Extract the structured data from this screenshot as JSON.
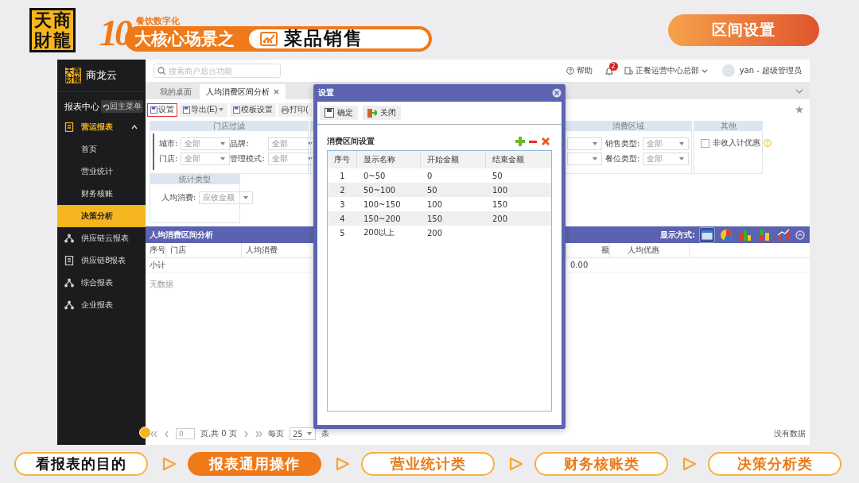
{
  "header": {
    "logo": "天商財龍",
    "number": "10",
    "subtitle": "餐饮数字化",
    "banner_text": "大核心场景之",
    "topic": "菜品销售",
    "section_badge": "区间设置"
  },
  "app": {
    "sidebar": {
      "logo": "天商財龍",
      "brand": "商龙云",
      "section": "报表中心",
      "back_button": "回主菜单",
      "groups": [
        {
          "label": "营运报表",
          "kind": "doc",
          "expanded": true,
          "children": [
            {
              "label": "首页",
              "selected": false
            },
            {
              "label": "营业统计",
              "selected": false
            },
            {
              "label": "财务核账",
              "selected": false
            },
            {
              "label": "决策分析",
              "selected": true
            }
          ]
        },
        {
          "label": "供应链云报表",
          "kind": "network"
        },
        {
          "label": "供应链8报表",
          "kind": "doc"
        },
        {
          "label": "综合报表",
          "kind": "network"
        },
        {
          "label": "企业报表",
          "kind": "network"
        }
      ]
    },
    "topbar": {
      "search_placeholder": "搜索商户后台功能",
      "help": "帮助",
      "notifications": "2",
      "org": "正餐运营中心总部",
      "user": "yan - 超级管理员"
    },
    "tabs": [
      {
        "label": "我的桌面",
        "selected": false
      },
      {
        "label": "人均消费区间分析",
        "selected": true
      }
    ],
    "toolbar": [
      {
        "label": "设置",
        "highlighted": true,
        "dropdown": false
      },
      {
        "label": "导出(E)",
        "highlighted": false,
        "dropdown": true
      },
      {
        "label": "模板设置",
        "highlighted": false,
        "dropdown": false
      },
      {
        "label": "打印(",
        "highlighted": false,
        "dropdown": false
      }
    ],
    "store_filter": {
      "title": "门店过滤",
      "fields": [
        {
          "label": "城市:",
          "value": "全部"
        },
        {
          "label": "品牌:",
          "value": "全部"
        },
        {
          "label": "门店:",
          "value": "全部"
        },
        {
          "label": "管理模式:",
          "value": "全部"
        }
      ]
    },
    "stat_type": {
      "title": "统计类型",
      "fields": [
        {
          "label": "人均消费:",
          "value": "应收金额"
        }
      ]
    },
    "consumption_area": {
      "title": "消费区域",
      "fields": [
        {
          "label": "销售类型:",
          "value": "全部"
        },
        {
          "label": "餐位类型:",
          "value": "全部"
        }
      ]
    },
    "other": {
      "title": "其他",
      "checkbox": {
        "label": "非收入计优惠",
        "checked": false
      }
    },
    "report": {
      "title": "人均消费区间分析",
      "view_label": "显示方式:",
      "view_modes": [
        {
          "kind": "table",
          "selected": true
        },
        {
          "kind": "pie",
          "selected": false
        },
        {
          "kind": "bar",
          "selected": false
        },
        {
          "kind": "stacked",
          "selected": false
        },
        {
          "kind": "combo",
          "selected": false
        }
      ],
      "columns": [
        "序号",
        "门店",
        "人均消费"
      ],
      "right_columns": [
        "额",
        "人均优惠"
      ],
      "subtotal_label": "小计",
      "subtotal_value": "0.00",
      "empty_text": "无数据"
    },
    "pager": {
      "page": "0",
      "page_text": "页,共 0 页",
      "per_page_label": "每页",
      "per_page": "25",
      "unit": "条",
      "status": "没有数据"
    },
    "dialog": {
      "title": "设置",
      "buttons": [
        {
          "label": "确定",
          "kind": "save"
        },
        {
          "label": "关闭",
          "kind": "exit"
        }
      ],
      "section": "消费区间设置",
      "columns": [
        "序号",
        "显示名称",
        "开始金额",
        "结束金额"
      ],
      "rows": [
        {
          "no": "1",
          "name": "0~50",
          "start": "0",
          "end": "50"
        },
        {
          "no": "2",
          "name": "50~100",
          "start": "50",
          "end": "100"
        },
        {
          "no": "3",
          "name": "100~150",
          "start": "100",
          "end": "150"
        },
        {
          "no": "4",
          "name": "150~200",
          "start": "150",
          "end": "200"
        },
        {
          "no": "5",
          "name": "200以上",
          "start": "200"
        }
      ]
    }
  },
  "steps": [
    {
      "label": "看报表的目的",
      "selected": false,
      "visited": true
    },
    {
      "label": "报表通用操作",
      "selected": true,
      "visited": true
    },
    {
      "label": "营业统计类",
      "selected": false,
      "visited": false
    },
    {
      "label": "财务核账类",
      "selected": false,
      "visited": false
    },
    {
      "label": "决策分析类",
      "selected": false,
      "visited": false
    }
  ]
}
